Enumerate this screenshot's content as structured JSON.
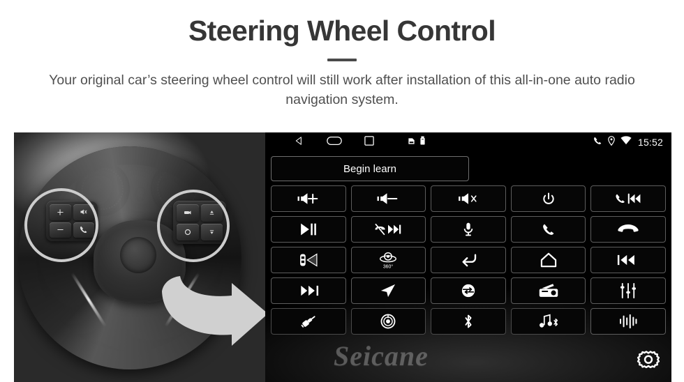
{
  "header": {
    "title": "Steering Wheel Control",
    "subtitle": "Your original car’s steering wheel control will still work after installation of this all-in-one auto radio navigation system."
  },
  "colors": {
    "highlight_yellow": "#F2CF3B",
    "arrow_yellow": "#F5D340",
    "title_text": "#363636",
    "subtitle_text": "#4f4f4f",
    "screen_background": "#000000",
    "button_border": "#5d5d5d"
  },
  "left_photo": {
    "name": "steering-wheel-photo",
    "description": "Grayscale photo of a car steering wheel with two yellow circle highlights over the multifunction button clusters and a yellow curved arrow pointing right",
    "left_cluster": {
      "name": "left-button-cluster",
      "keys": [
        {
          "name": "volume-up-key",
          "glyph": "+"
        },
        {
          "name": "mute-key",
          "glyph": "mute-icon"
        },
        {
          "name": "volume-down-key",
          "glyph": "−"
        },
        {
          "name": "phone-key",
          "glyph": "phone-icon"
        }
      ]
    },
    "right_cluster": {
      "name": "right-button-cluster",
      "keys": [
        {
          "name": "source-key",
          "glyph": "source-icon"
        },
        {
          "name": "up-key",
          "glyph": "up-arrow-icon"
        },
        {
          "name": "menu-key",
          "glyph": "circle-icon"
        },
        {
          "name": "down-key",
          "glyph": "down-arrow-icon"
        }
      ]
    }
  },
  "screen": {
    "status_bar": {
      "nav": [
        {
          "name": "back-icon",
          "label": "back"
        },
        {
          "name": "home-icon",
          "label": "home"
        },
        {
          "name": "recents-icon",
          "label": "recents"
        }
      ],
      "indicators": [
        {
          "name": "sd-card-icon",
          "label": "sd card"
        },
        {
          "name": "usb-icon",
          "label": "usb"
        }
      ],
      "right_indicators": [
        {
          "name": "phone-icon",
          "label": "phone"
        },
        {
          "name": "location-pin-icon",
          "label": "location"
        },
        {
          "name": "wifi-icon",
          "label": "wifi"
        }
      ],
      "time": "15:52"
    },
    "begin_learn_label": "Begin learn",
    "buttons": [
      {
        "name": "volume-up-button",
        "icon": "volume-up-icon"
      },
      {
        "name": "volume-down-button",
        "icon": "volume-down-icon"
      },
      {
        "name": "mute-button",
        "icon": "volume-mute-icon"
      },
      {
        "name": "power-button",
        "icon": "power-icon"
      },
      {
        "name": "call-previous-button",
        "icon": "phone-previous-icon"
      },
      {
        "name": "play-pause-button",
        "icon": "play-pause-icon"
      },
      {
        "name": "hangup-next-button",
        "icon": "hangup-next-icon"
      },
      {
        "name": "voice-mic-button",
        "icon": "microphone-icon"
      },
      {
        "name": "answer-call-button",
        "icon": "phone-icon"
      },
      {
        "name": "end-call-button",
        "icon": "phone-hangup-icon"
      },
      {
        "name": "parking-sensor-button",
        "icon": "car-radar-icon"
      },
      {
        "name": "camera-360-button",
        "icon": "camera-360-icon",
        "label": "360°"
      },
      {
        "name": "back-button",
        "icon": "back-arrow-icon"
      },
      {
        "name": "home-button",
        "icon": "home-icon"
      },
      {
        "name": "previous-track-button",
        "icon": "previous-track-icon"
      },
      {
        "name": "next-track-button",
        "icon": "next-track-icon"
      },
      {
        "name": "navigation-button",
        "icon": "navigation-arrow-icon"
      },
      {
        "name": "source-switch-button",
        "icon": "source-switch-icon"
      },
      {
        "name": "radio-button",
        "icon": "radio-icon"
      },
      {
        "name": "equalizer-button",
        "icon": "equalizer-icon"
      },
      {
        "name": "aux-usb-button",
        "icon": "plug-cable-icon"
      },
      {
        "name": "disc-button",
        "icon": "disc-icon"
      },
      {
        "name": "bluetooth-button",
        "icon": "bluetooth-icon"
      },
      {
        "name": "bluetooth-music-button",
        "icon": "bluetooth-music-icon"
      },
      {
        "name": "voice-wave-button",
        "icon": "voice-waveform-icon"
      }
    ],
    "watermark": "Seicane",
    "settings": {
      "name": "settings-gear-icon",
      "label": "settings"
    }
  }
}
